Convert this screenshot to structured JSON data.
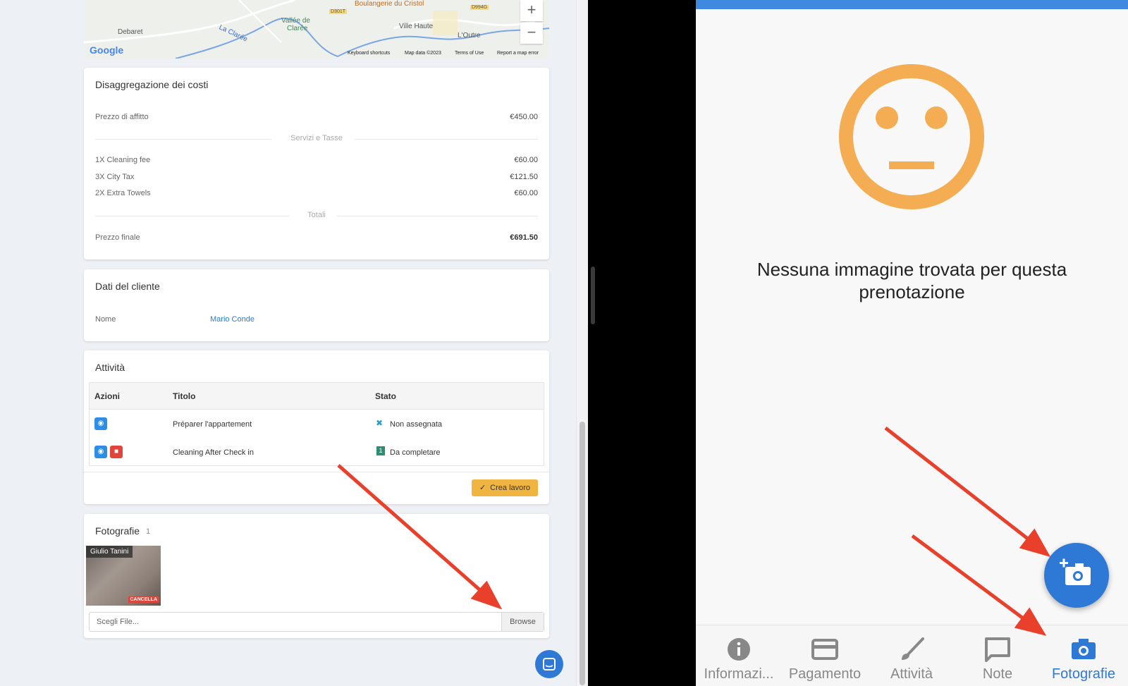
{
  "map": {
    "places": [
      "Debaret",
      "La Clarée",
      "Vallée de",
      "Clarée",
      "Ville Haute",
      "L'Outre",
      "Boulangerie du Cristol",
      "D301T",
      "D994G"
    ],
    "google": "Google",
    "zoom_in": "+",
    "zoom_out": "−",
    "footer": [
      "Keyboard shortcuts",
      "Map data ©2023",
      "Terms of Use",
      "Report a map error"
    ]
  },
  "costs": {
    "title": "Disaggregazione dei costi",
    "rent_label": "Prezzo di affitto",
    "rent_value": "€450.00",
    "services_divider": "Servizi e Tasse",
    "items": [
      {
        "label": "1X Cleaning fee",
        "value": "€60.00"
      },
      {
        "label": "3X City Tax",
        "value": "€121.50"
      },
      {
        "label": "2X Extra Towels",
        "value": "€60.00"
      }
    ],
    "totals_divider": "Totali",
    "final_label": "Prezzo finale",
    "final_value": "€691.50"
  },
  "client": {
    "title": "Dati del cliente",
    "name_label": "Nome",
    "name_value": "Mario Conde"
  },
  "activities": {
    "title": "Attività",
    "headers": {
      "actions": "Azioni",
      "title": "Titolo",
      "status": "Stato"
    },
    "rows": [
      {
        "title": "Préparer l'appartement",
        "status": "Non assegnata"
      },
      {
        "title": "Cleaning After Check in",
        "status": "Da completare"
      }
    ],
    "create_button": "Crea lavoro"
  },
  "photos": {
    "title": "Fotografie",
    "count": "1",
    "thumb_author": "Giulio Tanini",
    "delete_label": "CANCELLA",
    "file_placeholder": "Scegli File...",
    "browse_label": "Browse"
  },
  "mobile": {
    "empty_text_line1": "Nessuna immagine trovata per questa",
    "empty_text_line2": "prenotazione",
    "nav": [
      {
        "label": "Informazi...",
        "icon": "info-icon",
        "active": false
      },
      {
        "label": "Pagamento",
        "icon": "credit-card-icon",
        "active": false
      },
      {
        "label": "Attività",
        "icon": "brush-icon",
        "active": false
      },
      {
        "label": "Note",
        "icon": "chat-icon",
        "active": false
      },
      {
        "label": "Fotografie",
        "icon": "camera-icon",
        "active": true
      }
    ]
  },
  "colors": {
    "accent_blue": "#2e78d6",
    "smiley_orange": "#f4ad52",
    "create_button": "#f0b441",
    "danger": "#e0453c",
    "annotation_arrow": "#e8402a"
  }
}
